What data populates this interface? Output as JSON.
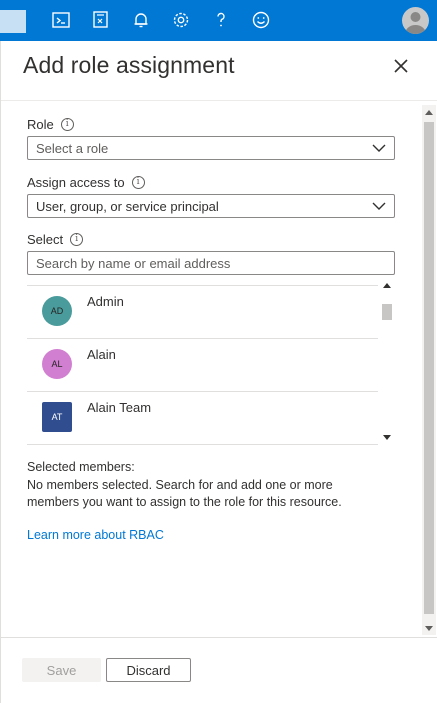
{
  "topbar": {
    "icons": [
      "cloud-shell-icon",
      "directory-filter-icon",
      "notifications-bell-icon",
      "settings-gear-icon",
      "help-question-icon",
      "feedback-smiley-icon"
    ]
  },
  "panel": {
    "title": "Add role assignment",
    "close_icon": "close-icon"
  },
  "form": {
    "role": {
      "label": "Role",
      "placeholder": "Select a role"
    },
    "assign_access": {
      "label": "Assign access to",
      "value": "User, group, or service principal"
    },
    "select": {
      "label": "Select",
      "placeholder": "Search by name or email address"
    }
  },
  "members": [
    {
      "initials": "AD",
      "name": "Admin",
      "color": "#4a9b9b",
      "shape": "circle"
    },
    {
      "initials": "AL",
      "name": "Alain",
      "color": "#d17fd0",
      "shape": "circle"
    },
    {
      "initials": "AT",
      "name": "Alain Team",
      "color": "#2f4d8f",
      "shape": "square"
    }
  ],
  "selected": {
    "title": "Selected members:",
    "description": "No members selected. Search for and add one or more members you want to assign to the role for this resource.",
    "learn_more": "Learn more about RBAC"
  },
  "footer": {
    "save_label": "Save",
    "discard_label": "Discard"
  },
  "colors": {
    "accent": "#0078d4",
    "link": "#0078d4"
  }
}
